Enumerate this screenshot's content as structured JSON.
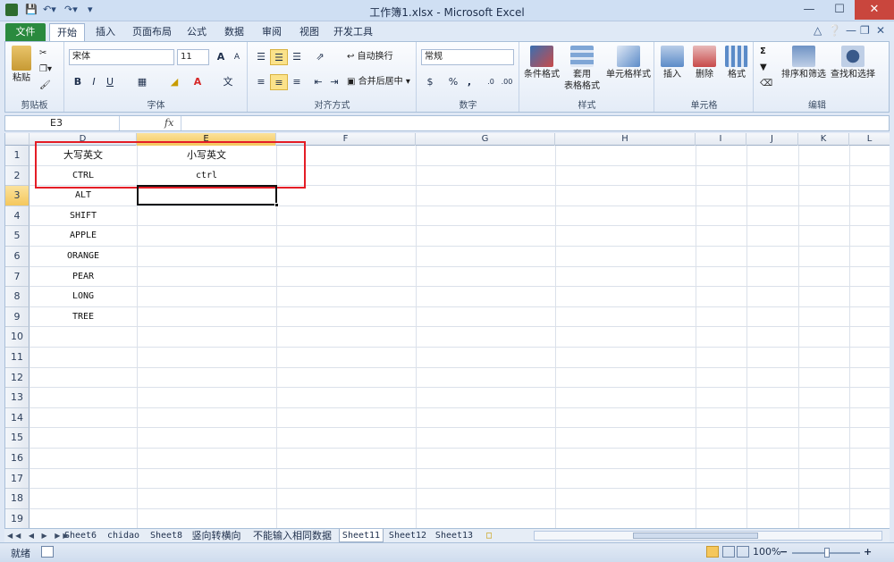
{
  "window": {
    "title": "工作簿1.xlsx - Microsoft Excel"
  },
  "tabs": [
    "文件",
    "开始",
    "插入",
    "页面布局",
    "公式",
    "数据",
    "审阅",
    "视图",
    "开发工具"
  ],
  "ribbon": {
    "clipboard": {
      "paste": "粘贴",
      "label": "剪贴板"
    },
    "font": {
      "name": "宋体",
      "size": "11",
      "bold": "B",
      "italic": "I",
      "underline": "U",
      "grow": "A",
      "shrink": "A",
      "label": "字体"
    },
    "align": {
      "wrap": "自动换行",
      "merge": "合并后居中",
      "label": "对齐方式"
    },
    "number": {
      "format": "常规",
      "percent": "%",
      "comma": ",",
      "label": "数字"
    },
    "styles": {
      "cond": "条件格式",
      "table1": "套用",
      "table2": "表格格式",
      "cell": "单元格样式",
      "label": "样式"
    },
    "cells": {
      "insert": "插入",
      "delete": "删除",
      "format": "格式",
      "label": "单元格"
    },
    "edit": {
      "sigma": "Σ",
      "sort": "排序和筛选",
      "find": "查找和选择",
      "label": "编辑"
    }
  },
  "formula": {
    "namebox": "E3",
    "fx": "fx"
  },
  "columns": [
    "D",
    "E",
    "F",
    "G",
    "H",
    "I",
    "J",
    "K",
    "L"
  ],
  "rows": [
    "1",
    "2",
    "3",
    "4",
    "5",
    "6",
    "7",
    "8",
    "9",
    "10",
    "11",
    "12",
    "13",
    "14",
    "15",
    "16",
    "17",
    "18",
    "19"
  ],
  "cells": {
    "d": [
      "大写英文",
      "CTRL",
      "ALT",
      "SHIFT",
      "APPLE",
      "ORANGE",
      "PEAR",
      "LONG",
      "TREE"
    ],
    "e": [
      "小写英文",
      "ctrl"
    ]
  },
  "sheets": [
    "Sheet6",
    "chidao",
    "Sheet8",
    "竖向转横向",
    "不能输入相同数据",
    "Sheet11",
    "Sheet12",
    "Sheet13"
  ],
  "status": {
    "ready": "就绪",
    "zoom": "100%",
    "minus": "−",
    "plus": "+"
  }
}
